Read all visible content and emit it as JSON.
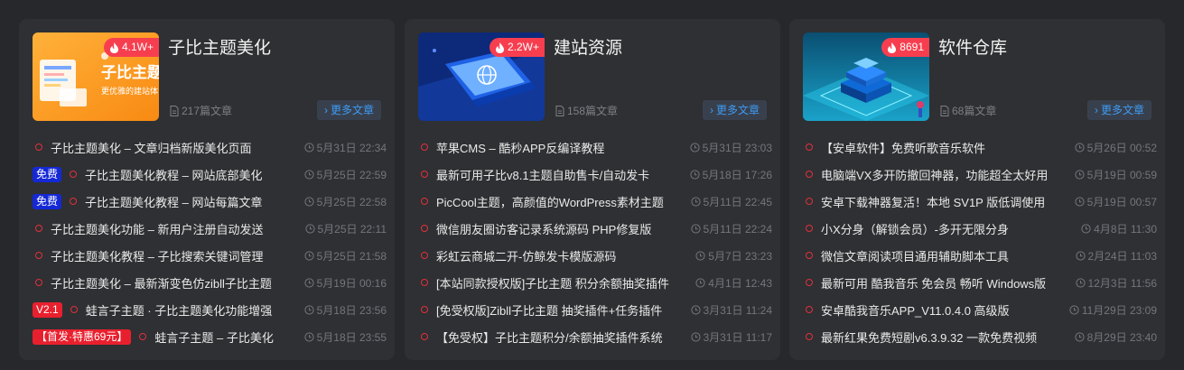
{
  "cards": [
    {
      "title": "子比主题美化",
      "hot": "4.1W+",
      "count": "217篇文章",
      "more": "更多文章",
      "thumb_text": "子比主题",
      "thumb_sub": "更优雅的建站体",
      "items": [
        {
          "tag": "",
          "text": "子比主题美化 – 文章归档新版美化页面",
          "time": "5月31日 22:34"
        },
        {
          "tag": "免费",
          "text": "子比主题美化教程 – 网站底部美化",
          "time": "5月25日 22:59"
        },
        {
          "tag": "免费",
          "text": "子比主题美化教程 – 网站每篇文章",
          "time": "5月25日 22:58"
        },
        {
          "tag": "",
          "text": "子比主题美化功能 – 新用户注册自动发送",
          "time": "5月25日 22:11"
        },
        {
          "tag": "",
          "text": "子比主题美化教程 – 子比搜索关键词管理",
          "time": "5月25日 21:58"
        },
        {
          "tag": "",
          "text": "子比主题美化 – 最新渐变色仿zibll子比主题",
          "time": "5月19日 00:16"
        },
        {
          "tag": "V2.1",
          "text": "蛙言子主题 · 子比主题美化功能增强",
          "time": "5月18日 23:56"
        },
        {
          "tag": "【首发·特惠69元】",
          "text": "蛙言子主题 – 子比美化",
          "time": "5月18日 23:55"
        }
      ]
    },
    {
      "title": "建站资源",
      "hot": "2.2W+",
      "count": "158篇文章",
      "more": "更多文章",
      "items": [
        {
          "tag": "",
          "text": "苹果CMS – 酷秒APP反编译教程",
          "time": "5月31日 23:03"
        },
        {
          "tag": "",
          "text": "最新可用子比v8.1主题自助售卡/自动发卡",
          "time": "5月18日 17:26"
        },
        {
          "tag": "",
          "text": "PicCool主题，高颜值的WordPress素材主题",
          "time": "5月11日 22:45"
        },
        {
          "tag": "",
          "text": "微信朋友圈访客记录系统源码 PHP修复版",
          "time": "5月11日 22:24"
        },
        {
          "tag": "",
          "text": "彩虹云商城二开-仿鲸发卡模版源码",
          "time": "5月7日 23:23"
        },
        {
          "tag": "",
          "text": "[本站同款授权版]子比主题 积分余额抽奖插件",
          "time": "4月1日 12:43"
        },
        {
          "tag": "",
          "text": "[免受权版]Zibll子比主题 抽奖插件+任务插件",
          "time": "3月31日 11:24"
        },
        {
          "tag": "",
          "text": "【免受权】子比主题积分/余额抽奖插件系统",
          "time": "3月31日 11:17"
        }
      ]
    },
    {
      "title": "软件仓库",
      "hot": "8691",
      "count": "68篇文章",
      "more": "更多文章",
      "items": [
        {
          "tag": "",
          "text": "【安卓软件】免费听歌音乐软件",
          "time": "5月26日 00:52"
        },
        {
          "tag": "",
          "text": "电脑端VX多开防撤回神器，功能超全太好用",
          "time": "5月19日 00:59"
        },
        {
          "tag": "",
          "text": "安卓下载神器复活！本地 SV1P 版低调使用",
          "time": "5月19日 00:57"
        },
        {
          "tag": "",
          "text": "小X分身（解锁会员）-多开无限分身",
          "time": "4月8日 11:30"
        },
        {
          "tag": "",
          "text": "微信文章阅读项目通用辅助脚本工具",
          "time": "2月24日 11:03"
        },
        {
          "tag": "",
          "text": "最新可用 酷我音乐 免会员 畅听 Windows版",
          "time": "12月3日 11:56"
        },
        {
          "tag": "",
          "text": "安卓酷我音乐APP_V11.0.4.0 高级版",
          "time": "11月29日 23:09"
        },
        {
          "tag": "",
          "text": "最新红果免费短剧v6.3.9.32 一款免费视频",
          "time": "8月29日 23:40"
        }
      ]
    }
  ],
  "colors": {
    "hot": "#f73e4f",
    "more_text": "#3d9bf5",
    "dot": "#e0303c",
    "tag_free": "#1428d6",
    "tag_red": "#e8202e"
  }
}
